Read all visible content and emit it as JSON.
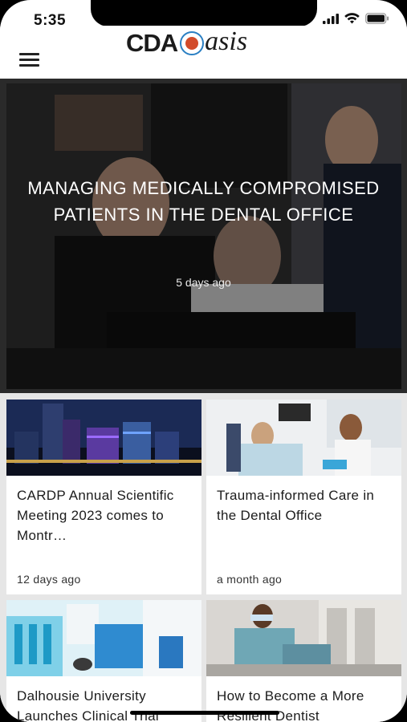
{
  "status_bar": {
    "time": "5:35"
  },
  "header": {
    "logo_left": "CDA",
    "logo_right": "asis"
  },
  "hero": {
    "title": "MANAGING MEDICALLY COMPROMISED PATIENTS IN THE DENTAL OFFICE",
    "date": "5 days ago"
  },
  "articles": [
    {
      "title": "CARDP Annual Scientific Meeting 2023 comes to Montr…",
      "date": "12 days ago"
    },
    {
      "title": "Trauma-informed Care in the Dental Office",
      "date": "a month ago"
    },
    {
      "title": "Dalhousie University Launches Clinical Trial",
      "date": ""
    },
    {
      "title": "How to Become a More Resilient Dentist",
      "date": ""
    }
  ],
  "icons": {
    "menu": "hamburger-menu-icon",
    "wifi": "wifi-icon",
    "battery": "battery-icon",
    "signal": "cellular-signal-icon"
  }
}
